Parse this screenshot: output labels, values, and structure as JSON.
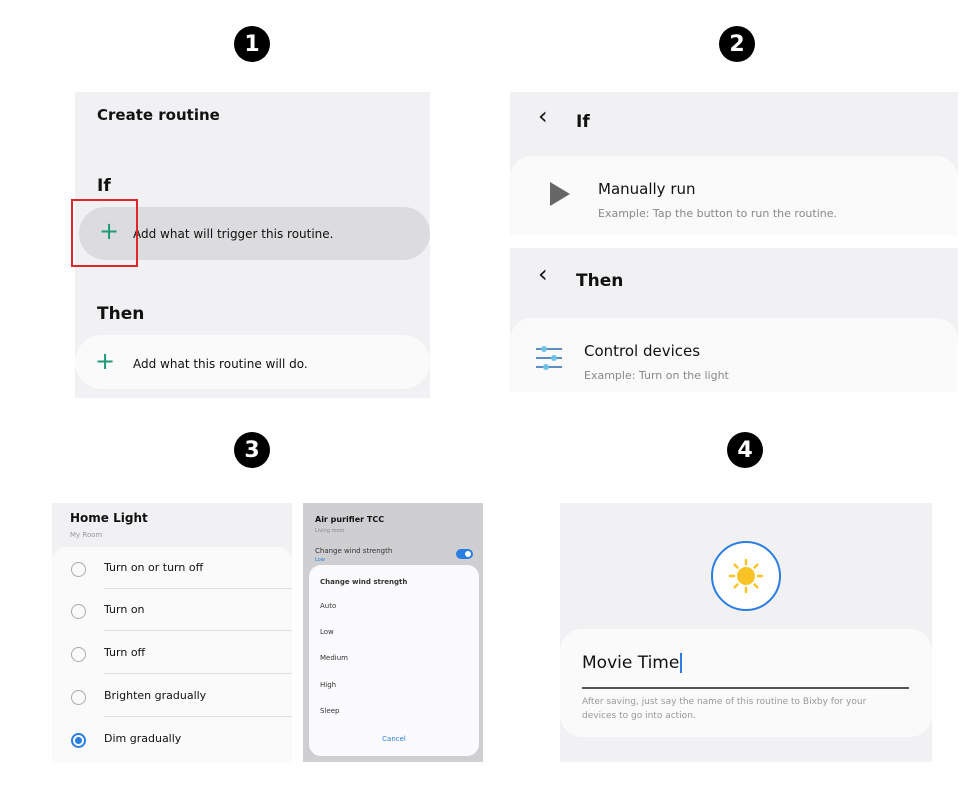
{
  "steps": [
    "1",
    "2",
    "3",
    "4"
  ],
  "panel1": {
    "title": "Create routine",
    "if_label": "If",
    "if_add": "Add what will trigger this routine.",
    "then_label": "Then",
    "then_add": "Add what this routine will do.",
    "plus_icon": "plus-icon",
    "highlight_color": "#e0262b",
    "accent": "#1d9a78"
  },
  "panel2": {
    "if_title": "If",
    "if_option": {
      "title": "Manually run",
      "example": "Example: Tap the button to run the routine."
    },
    "then_title": "Then",
    "then_option": {
      "title": "Control devices",
      "example": "Example: Turn on the light"
    }
  },
  "panel3": {
    "device": "Home Light",
    "room": "My Room",
    "options": [
      {
        "label": "Turn on or turn off",
        "selected": false
      },
      {
        "label": "Turn on",
        "selected": false
      },
      {
        "label": "Turn off",
        "selected": false
      },
      {
        "label": "Brighten gradually",
        "selected": false
      },
      {
        "label": "Dim gradually",
        "selected": true
      }
    ],
    "purifier": {
      "device": "Air purifier TCC",
      "room": "Living room",
      "setting": "Change wind strength",
      "setting_value": "Low",
      "toggle_on": true,
      "dialog_title": "Change wind strength",
      "choices": [
        "Auto",
        "Low",
        "Medium",
        "High",
        "Sleep"
      ],
      "cancel": "Cancel"
    }
  },
  "panel4": {
    "icon": "sun-icon",
    "name_value": "Movie Time",
    "hint": "After saving, just say the name of this routine to Bixby for your devices to go into action."
  }
}
